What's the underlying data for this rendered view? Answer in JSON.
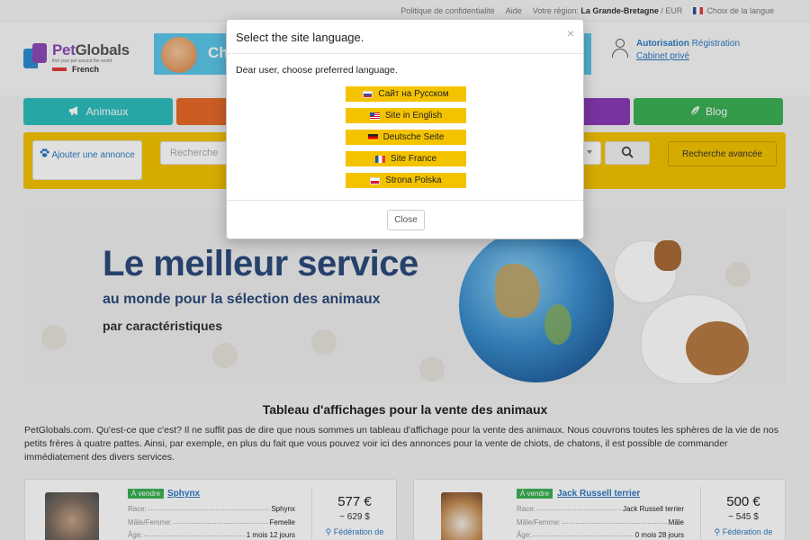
{
  "topbar": {
    "privacy": "Politique de confidentialité",
    "help": "Aide",
    "region_label": "Votre région:",
    "region_value": "La Grande-Bretagne",
    "currency": "/ EUR",
    "language": "Choix de la langue"
  },
  "logo": {
    "name_pet": "Pet",
    "name_rest": "Globals",
    "tagline": "find your pet around the world",
    "lang": "French"
  },
  "banner": {
    "text": "Ch"
  },
  "account": {
    "auth": "Autorisation",
    "register": "Régistration",
    "cabinet": "Cabinet privé"
  },
  "nav": {
    "animaux": "Animaux",
    "blog": "Blog"
  },
  "search": {
    "add_listing": "Ajouter une annonce",
    "placeholder": "Recherche",
    "advanced": "Recherche avancée"
  },
  "hero": {
    "title": "Le meilleur service",
    "subtitle1": "au monde pour la sélection des animaux",
    "subtitle2": "par caractéristiques"
  },
  "section": {
    "title": "Tableau d'affichages pour la vente des animaux",
    "text": "PetGlobals.com. Qu'est-ce que c'est? Il ne suffit pas de dire que nous sommes un tableau d'affichage pour la vente des animaux. Nous couvrons toutes les sphères de la vie de nos petits frères à quatre pattes. Ainsi, par exemple, en plus du fait que vous pouvez voir ici des annonces pour la vente de chiots, de chatons, il est possible de commander immédiatement des divers services."
  },
  "listings": [
    {
      "badge": "À vendre",
      "breed": "Sphynx",
      "rows": [
        {
          "label": "Race:",
          "value": "Sphynx"
        },
        {
          "label": "Mâle/Femme:",
          "value": "Femelle"
        },
        {
          "label": "Âge:",
          "value": "1 mois 12 jours"
        }
      ],
      "price": "577 €",
      "price_alt": "~ 629 $",
      "location": "Fédération de"
    },
    {
      "badge": "À vendre",
      "breed": "Jack Russell terrier",
      "rows": [
        {
          "label": "Race:",
          "value": "Jack Russell terrier"
        },
        {
          "label": "Mâle/Femme:",
          "value": "Mâle"
        },
        {
          "label": "Âge:",
          "value": "0 mois 28 jours"
        }
      ],
      "price": "500 €",
      "price_alt": "~ 545 $",
      "location": "Fédération de"
    }
  ],
  "modal": {
    "title": "Select the site language.",
    "close_x": "×",
    "message": "Dear user, choose preferred language.",
    "languages": [
      {
        "label": "Сайт на Русском",
        "flag": "flag-ru"
      },
      {
        "label": "Site in English",
        "flag": "flag-us"
      },
      {
        "label": "Deutsche Seite",
        "flag": "flag-de"
      },
      {
        "label": "Site France",
        "flag": "flag-fr"
      },
      {
        "label": "Strona Polska",
        "flag": "flag-pl"
      }
    ],
    "close_button": "Close"
  },
  "colors": {
    "teal": "#2cbfbd",
    "orange": "#e86a2a",
    "purple": "#8a3bb6",
    "green": "#3bb155",
    "yellow": "#f4c300",
    "link_blue": "#2e7ac3",
    "hero_navy": "#2c4a7c"
  }
}
